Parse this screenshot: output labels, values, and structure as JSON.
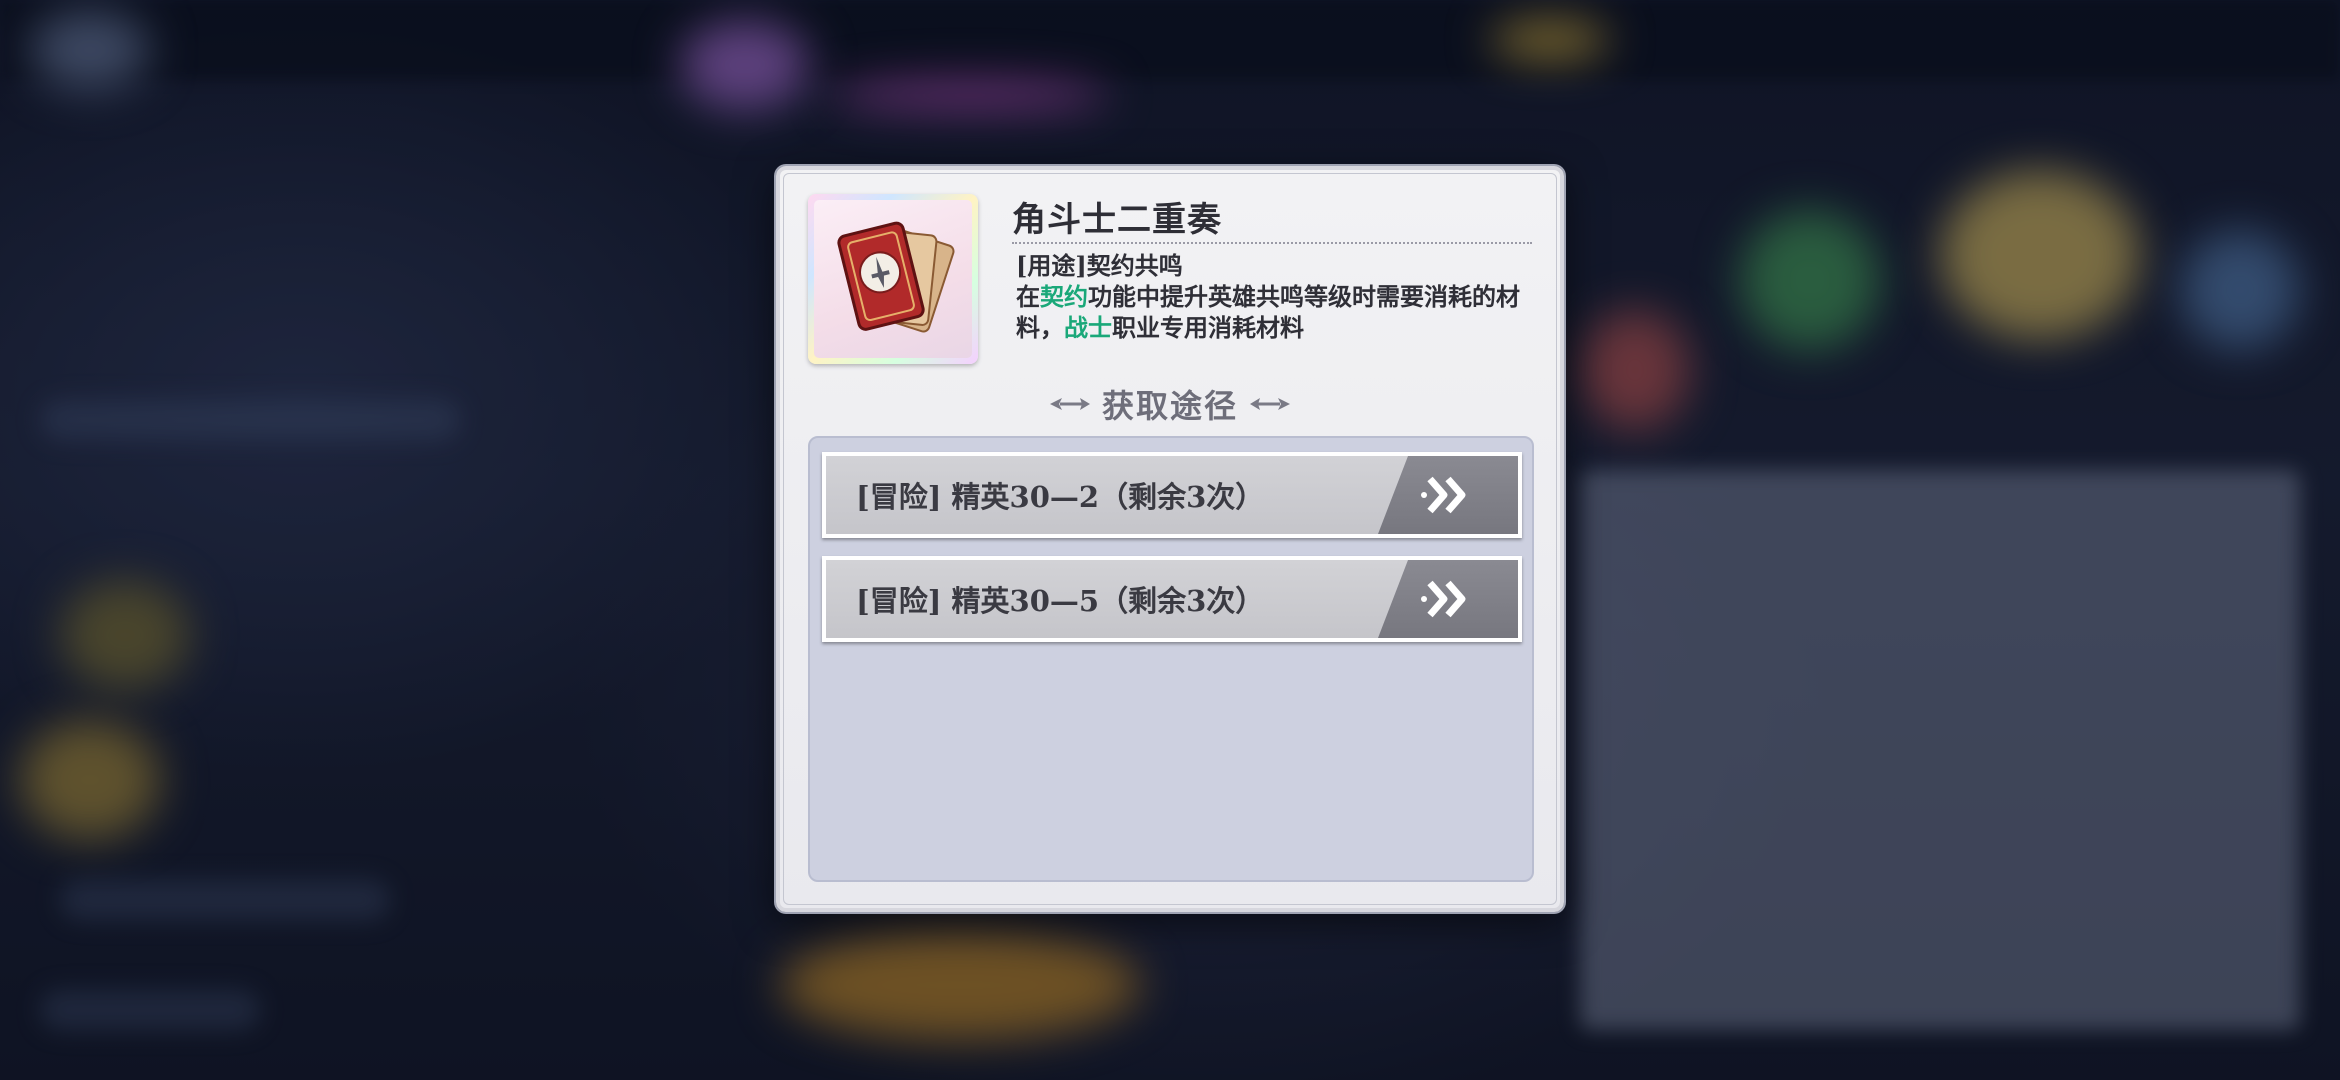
{
  "item": {
    "name": "角斗士二重奏",
    "usage_line": "[用途]契约共鸣",
    "desc_parts": {
      "p1": "在",
      "h1": "契约",
      "p2": "功能中提升英雄共鸣等级时需要消耗的材料，",
      "h2": "战士",
      "p3": "职业专用消耗材料"
    },
    "icon": "gladiator-card-icon"
  },
  "acquire": {
    "title": "获取途径",
    "routes": [
      {
        "label": "[冒险] 精英30—2（剩余3次）"
      },
      {
        "label": "[冒险] 精英30—5（剩余3次）"
      }
    ]
  },
  "colors": {
    "highlight": "#1aa879",
    "panel": "#cdd0e0",
    "button_arrow": "#808088"
  }
}
